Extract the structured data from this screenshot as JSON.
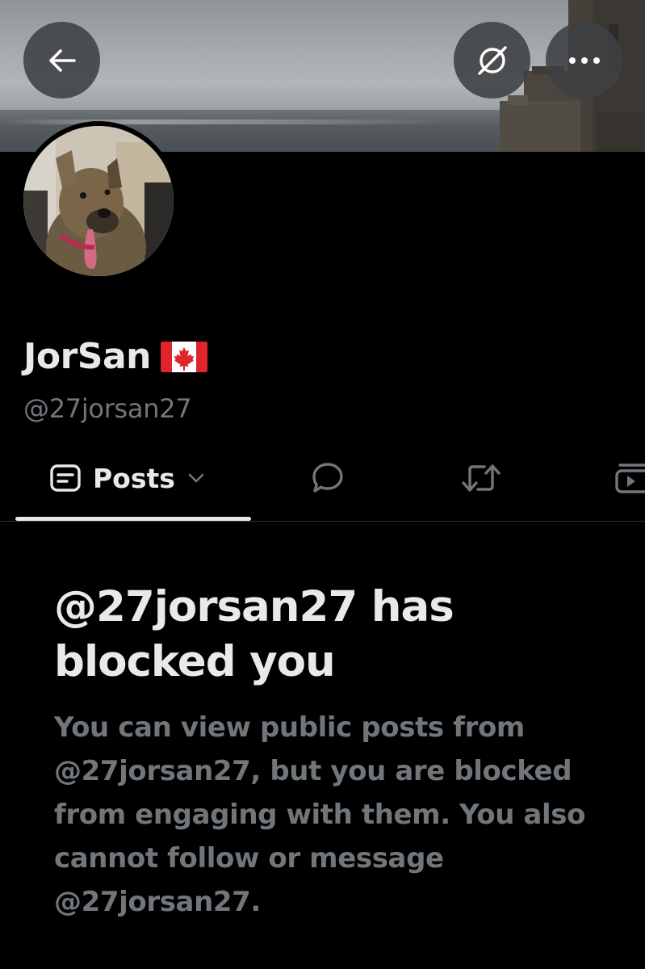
{
  "profile": {
    "display_name": "JorSan",
    "flag": "canada-flag",
    "handle": "@27jorsan27"
  },
  "header": {
    "back_icon": "back-arrow-icon",
    "grok_icon": "grok-icon",
    "more_icon": "more-icon"
  },
  "tabs": {
    "active_label": "Posts",
    "items": [
      {
        "icon": "posts-icon",
        "label": "Posts"
      },
      {
        "icon": "replies-icon"
      },
      {
        "icon": "repost-icon"
      },
      {
        "icon": "media-icon"
      }
    ]
  },
  "blocked": {
    "title": "@27jorsan27 has blocked you",
    "body": "You can view public posts from @27jorsan27, but you are blocked from engaging with them. You also cannot follow or message @27jorsan27."
  },
  "colors": {
    "background": "#000000",
    "primary_text": "#e7e9ea",
    "secondary_text": "#71767b",
    "button_bg": "#3e4042",
    "divider": "#2f3336"
  }
}
